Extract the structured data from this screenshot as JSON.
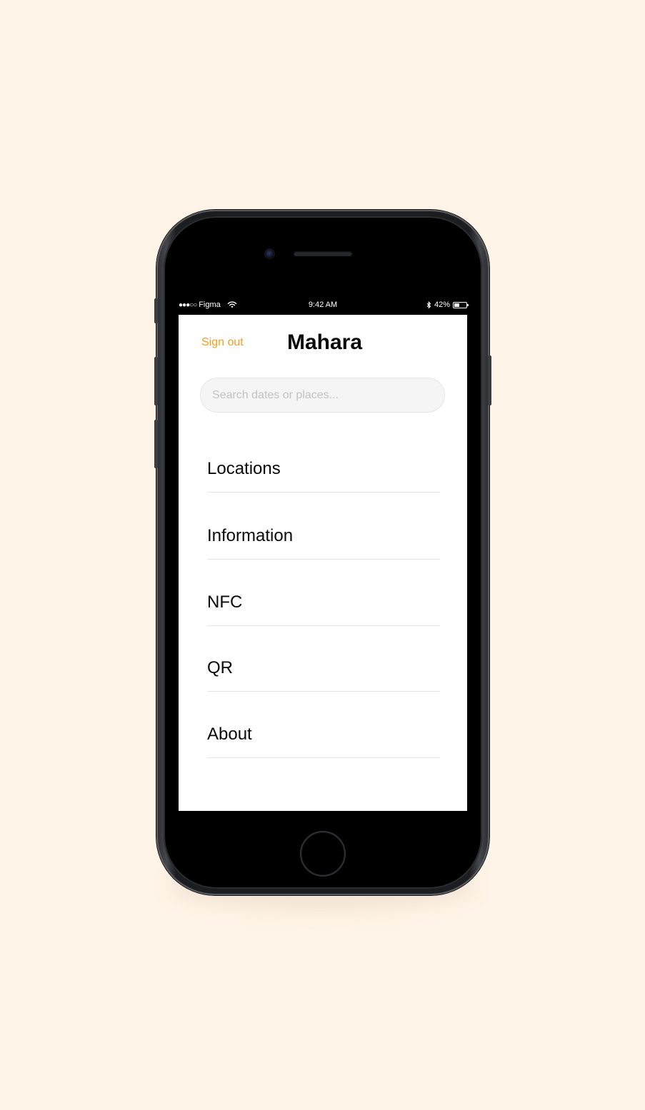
{
  "status_bar": {
    "signal": "●●●○○",
    "carrier": "Figma",
    "time": "9:42 AM",
    "battery": "42%",
    "battery_level": 0.42,
    "icons": [
      "wifi-icon",
      "bluetooth-icon",
      "battery-icon"
    ]
  },
  "header": {
    "sign_out_label": "Sign out",
    "title": "Mahara"
  },
  "search": {
    "placeholder": "Search dates or places...",
    "value": ""
  },
  "menu": {
    "items": [
      {
        "label": "Locations"
      },
      {
        "label": "Information"
      },
      {
        "label": "NFC"
      },
      {
        "label": "QR"
      },
      {
        "label": "About"
      }
    ]
  },
  "colors": {
    "background": "#FFF4E7",
    "accent": "#F2A01E",
    "text": "#0A0A0A",
    "divider": "#E4E4E4",
    "search_bg": "#F5F5F5"
  }
}
